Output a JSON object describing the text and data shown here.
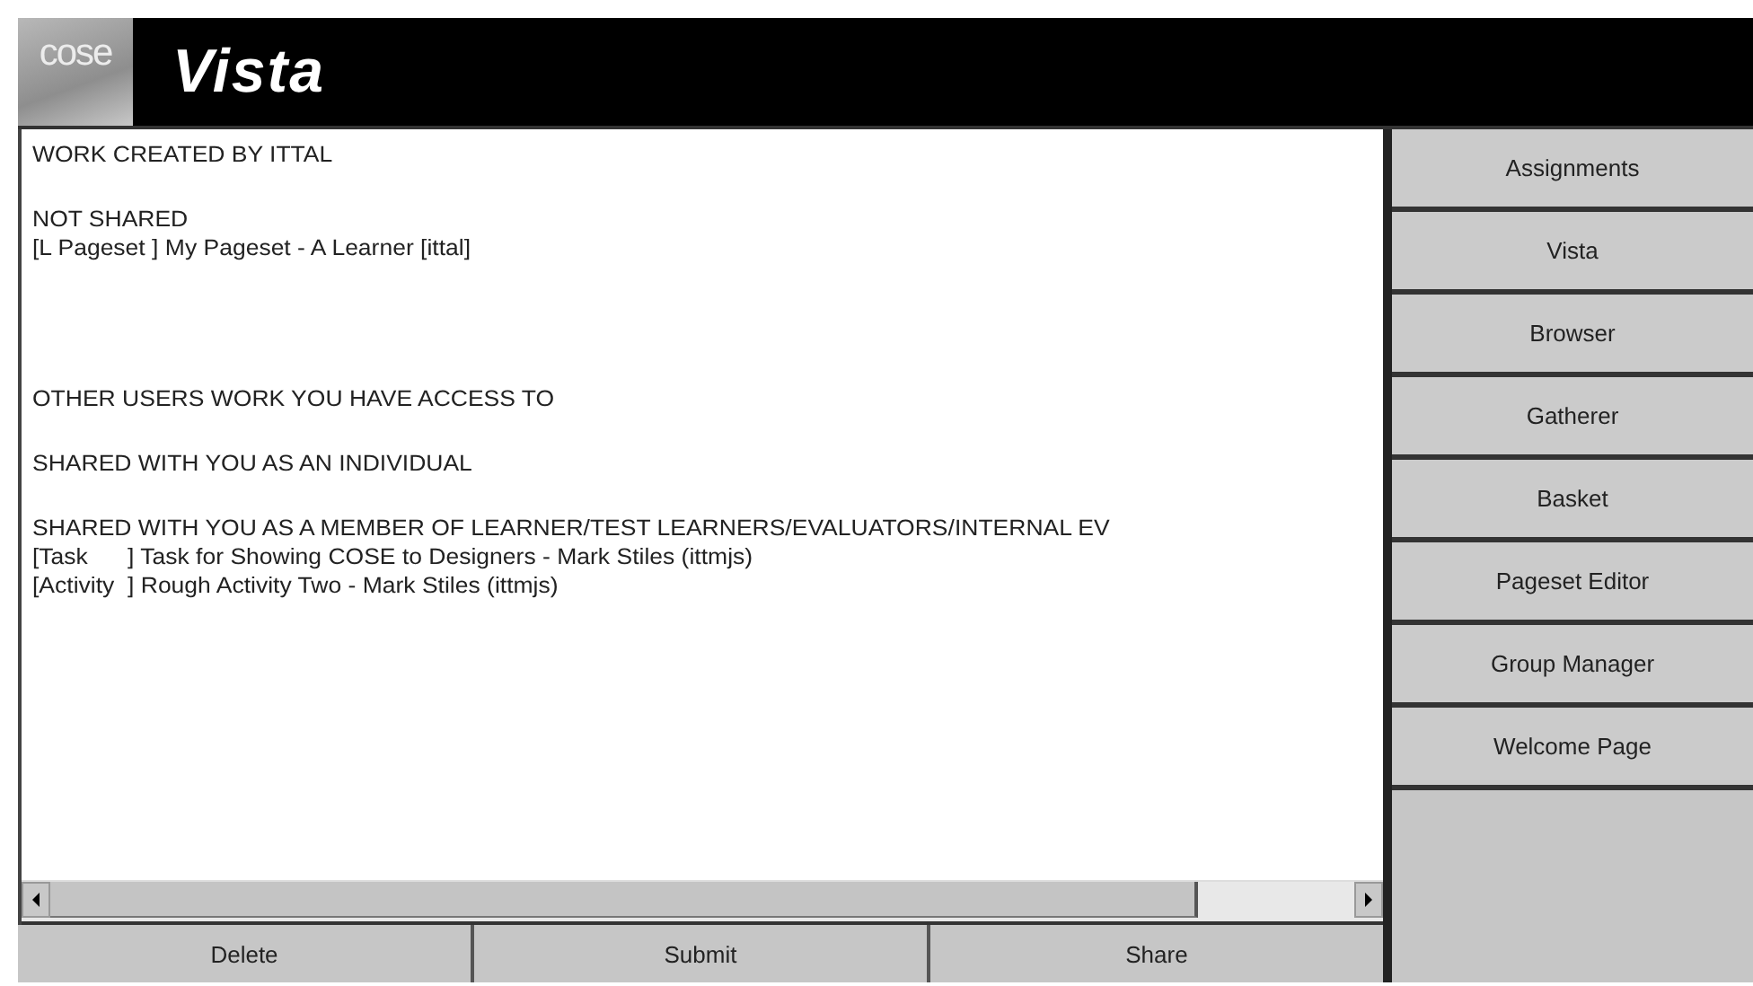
{
  "header": {
    "logo": "cose",
    "title": "Vista"
  },
  "content": {
    "lines": [
      {
        "kind": "heading",
        "text": "WORK CREATED BY ITTAL"
      },
      {
        "kind": "heading",
        "text": "NOT SHARED"
      },
      {
        "kind": "entry",
        "text": "[L Pageset ] My Pageset - A Learner [ittal]"
      },
      {
        "kind": "group",
        "text": "OTHER USERS WORK YOU HAVE ACCESS TO"
      },
      {
        "kind": "heading",
        "text": "SHARED WITH YOU AS AN INDIVIDUAL"
      },
      {
        "kind": "heading",
        "text": "SHARED WITH YOU AS A MEMBER OF LEARNER/TEST LEARNERS/EVALUATORS/INTERNAL EV"
      },
      {
        "kind": "entry",
        "text": "[Task      ] Task for Showing COSE to Designers - Mark Stiles (ittmjs)"
      },
      {
        "kind": "entry",
        "text": "[Activity  ] Rough Activity Two - Mark Stiles (ittmjs)"
      }
    ]
  },
  "actions": [
    "Delete",
    "Submit",
    "Share"
  ],
  "nav": [
    "Assignments",
    "Vista",
    "Browser",
    "Gatherer",
    "Basket",
    "Pageset Editor",
    "Group Manager",
    "Welcome Page"
  ]
}
